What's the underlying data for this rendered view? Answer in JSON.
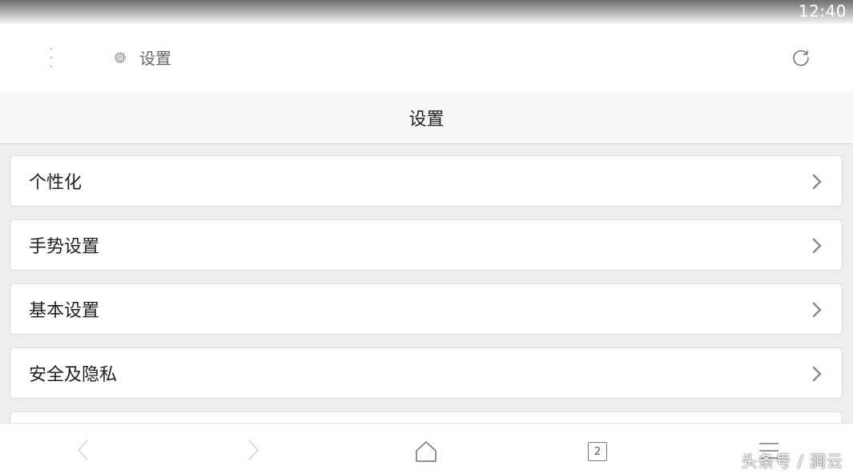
{
  "status_bar": {
    "time": "12:40"
  },
  "toolbar": {
    "tab_title": "设置"
  },
  "page": {
    "title": "设置"
  },
  "settings": {
    "items": [
      {
        "label": "个性化"
      },
      {
        "label": "手势设置"
      },
      {
        "label": "基本设置"
      },
      {
        "label": "安全及隐私"
      }
    ]
  },
  "nav": {
    "tab_count": "2"
  },
  "watermark": {
    "text": "头条号 / 涧云"
  }
}
